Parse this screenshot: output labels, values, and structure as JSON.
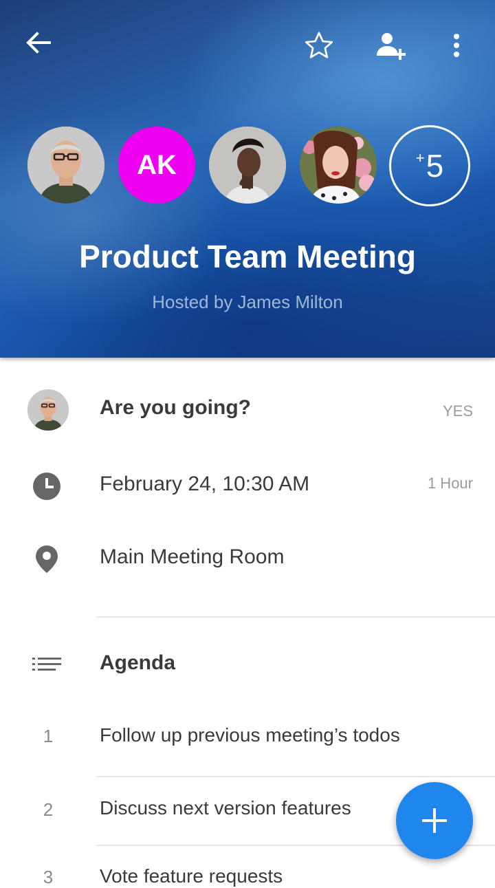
{
  "header": {
    "title": "Product Team Meeting",
    "subtitle": "Hosted by James Milton",
    "attendees": [
      {
        "type": "photo",
        "name": "man-gray-hair-avatar"
      },
      {
        "type": "initials",
        "initials": "AK",
        "color": "#f000f0"
      },
      {
        "type": "photo",
        "name": "woman-curly-hair-avatar"
      },
      {
        "type": "photo",
        "name": "woman-flowers-avatar"
      }
    ],
    "more_count": "5",
    "more_plus": "+"
  },
  "rsvp": {
    "question": "Are you going?",
    "answer": "YES"
  },
  "datetime": {
    "value": "February 24, 10:30 AM",
    "duration": "1 Hour"
  },
  "location": {
    "value": "Main Meeting Room"
  },
  "agenda": {
    "title": "Agenda",
    "items": [
      {
        "num": "1",
        "text": "Follow up previous meeting’s todos"
      },
      {
        "num": "2",
        "text": "Discuss next version features"
      },
      {
        "num": "3",
        "text": "Vote feature requests"
      }
    ]
  },
  "colors": {
    "accent": "#1f86ee",
    "initials_bg": "#f000f0"
  },
  "icons": [
    "back-arrow-icon",
    "star-icon",
    "add-person-icon",
    "more-vert-icon",
    "clock-icon",
    "location-pin-icon",
    "list-icon",
    "plus-icon"
  ]
}
